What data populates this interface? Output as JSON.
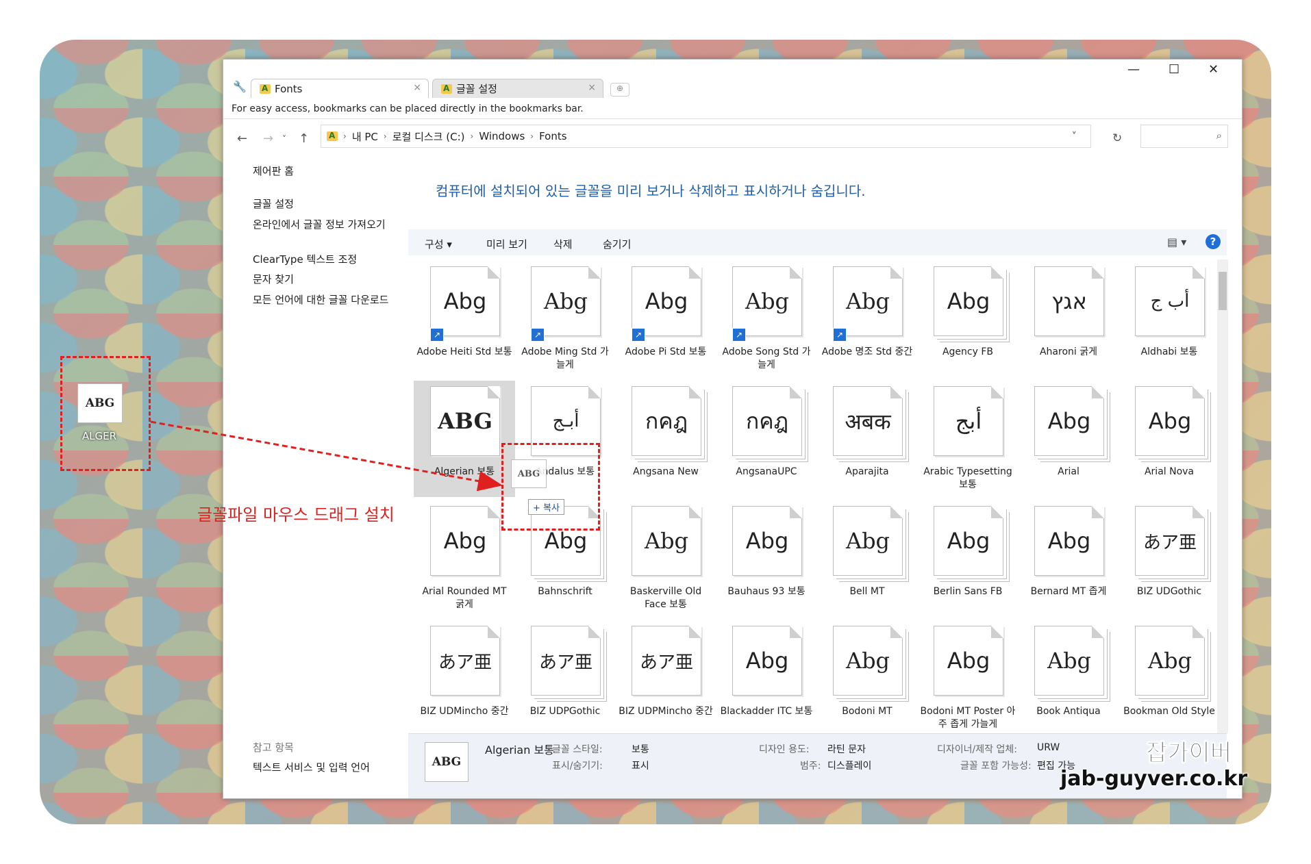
{
  "desktop": {
    "file_icon_text": "ABG",
    "file_label": "ALGER"
  },
  "annotation": {
    "caption": "글꼴파일 마우스 드래그 설치"
  },
  "tabs": [
    {
      "label": "Fonts",
      "close": "×"
    },
    {
      "label": "글꼴 설정",
      "close": "×"
    }
  ],
  "window_controls": {
    "minimize": "—",
    "maximize": "☐",
    "close": "✕"
  },
  "bookmarks_bar": {
    "text": "For easy access, bookmarks can be placed directly in the bookmarks bar."
  },
  "address": {
    "crumbs": [
      "내 PC",
      "로컬 디스크 (C:)",
      "Windows",
      "Fonts"
    ],
    "separator": "›"
  },
  "sidebar": {
    "items": [
      "제어판 홈",
      "글꼴 설정",
      "온라인에서 글꼴 정보 가져오기",
      "ClearType 텍스트 조정",
      "문자 찾기",
      "모든 언어에 대한 글꼴 다운로드"
    ],
    "see_also_title": "참고 항목",
    "see_also_items": [
      "텍스트 서비스 및 입력 언어"
    ]
  },
  "headline": "컴퓨터에 설치되어 있는 글꼴을 미리 보거나 삭제하고 표시하거나 숨깁니다.",
  "toolbar": {
    "organize": "구성 ▾",
    "preview": "미리 보기",
    "delete": "삭제",
    "hide": "숨기기",
    "help": "?"
  },
  "fonts": [
    {
      "name": "Adobe Heiti Std 보통",
      "sample": "Abg",
      "shortcut": true
    },
    {
      "name": "Adobe Ming Std 가늘게",
      "sample": "Abg",
      "shortcut": true
    },
    {
      "name": "Adobe Pi Std 보통",
      "sample": "Abg",
      "shortcut": true
    },
    {
      "name": "Adobe Song Std 가늘게",
      "sample": "Abg",
      "shortcut": true
    },
    {
      "name": "Adobe 명조 Std 중간",
      "sample": "Abg",
      "shortcut": true
    },
    {
      "name": "Agency FB",
      "sample": "Abg",
      "stack": true
    },
    {
      "name": "Aharoni 굵게",
      "sample": "אגץ"
    },
    {
      "name": "Aldhabi 보통",
      "sample": "أب ج"
    },
    {
      "name": "Algerian 보통",
      "sample": "ABG",
      "selected": true
    },
    {
      "name": "Andalus 보통",
      "sample": "أبـج"
    },
    {
      "name": "Angsana New",
      "sample": "กคฎ",
      "stack": true
    },
    {
      "name": "AngsanaUPC",
      "sample": "กคฎ",
      "stack": true
    },
    {
      "name": "Aparajita",
      "sample": "अबक",
      "stack": true
    },
    {
      "name": "Arabic Typesetting 보통",
      "sample": "أبج"
    },
    {
      "name": "Arial",
      "sample": "Abg",
      "stack": true
    },
    {
      "name": "Arial Nova",
      "sample": "Abg",
      "stack": true
    },
    {
      "name": "Arial Rounded MT 굵게",
      "sample": "Abg"
    },
    {
      "name": "Bahnschrift",
      "sample": "Abg",
      "stack": true
    },
    {
      "name": "Baskerville Old Face 보통",
      "sample": "Abg"
    },
    {
      "name": "Bauhaus 93 보통",
      "sample": "Abg"
    },
    {
      "name": "Bell MT",
      "sample": "Abg",
      "stack": true
    },
    {
      "name": "Berlin Sans FB",
      "sample": "Abg",
      "stack": true
    },
    {
      "name": "Bernard MT 좁게",
      "sample": "Abg"
    },
    {
      "name": "BIZ UDGothic",
      "sample": "あア亜",
      "stack": true
    },
    {
      "name": "BIZ UDMincho 중간",
      "sample": "あア亜"
    },
    {
      "name": "BIZ UDPGothic",
      "sample": "あア亜",
      "stack": true
    },
    {
      "name": "BIZ UDPMincho 중간",
      "sample": "あア亜"
    },
    {
      "name": "Blackadder ITC 보통",
      "sample": "Abg"
    },
    {
      "name": "Bodoni MT",
      "sample": "Abg",
      "stack": true
    },
    {
      "name": "Bodoni MT Poster 아주 좁게 가늘게",
      "sample": "Abg"
    },
    {
      "name": "Book Antiqua",
      "sample": "Abg",
      "stack": true
    },
    {
      "name": "Bookman Old Style",
      "sample": "Abg",
      "stack": true
    }
  ],
  "drag": {
    "ghost_text": "ABG",
    "tooltip": "+ 복사"
  },
  "details": {
    "name": "Algerian 보통",
    "thumb": "ABG",
    "style_label": "글꼴 스타일:",
    "style_value": "보통",
    "show_label": "표시/숨기기:",
    "show_value": "표시",
    "design_label": "디자인 용도:",
    "design_value": "라틴 문자",
    "category_label": "범주:",
    "category_value": "디스플레이",
    "designer_label": "디자이너/제작 업체:",
    "designer_value": "URW",
    "embed_label": "글꼴 포함 가능성:",
    "embed_value": "편집 가능"
  },
  "watermark": {
    "line1": "잡가이버",
    "line2": "jab-guyver.co.kr"
  },
  "colors": {
    "accent": "#1e5fa8",
    "annotation": "#e01f1f",
    "selection": "#d9d9d9"
  }
}
